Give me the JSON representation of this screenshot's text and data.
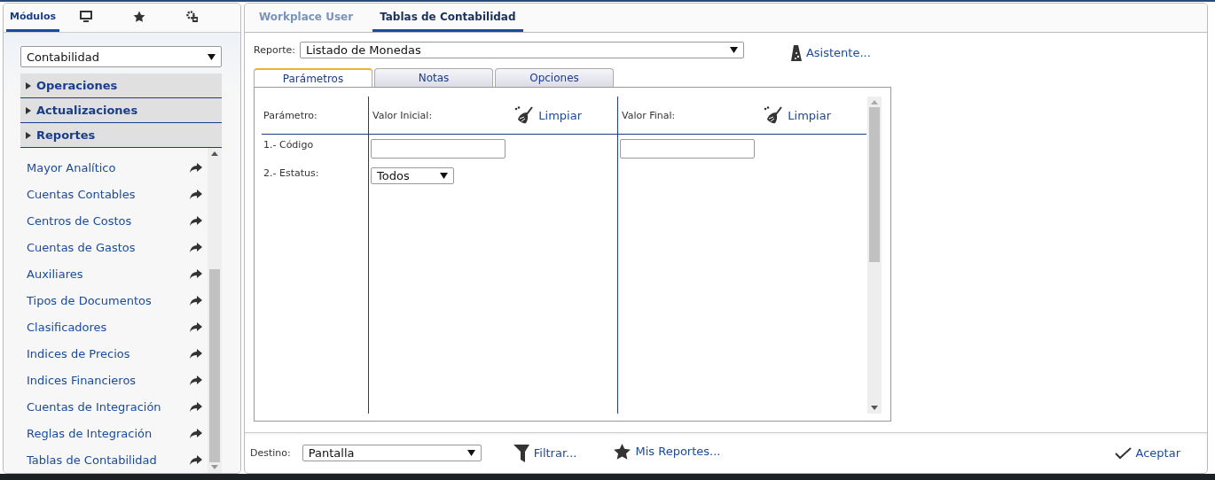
{
  "sidebar": {
    "tabs": [
      {
        "label": "Módulos",
        "selected": true
      },
      {
        "selected": false
      },
      {
        "selected": false
      },
      {
        "selected": false
      }
    ],
    "module_select": {
      "value": "Contabilidad"
    },
    "sections": [
      {
        "label": "Operaciones",
        "expanded": false
      },
      {
        "label": "Actualizaciones",
        "expanded": false
      },
      {
        "label": "Reportes",
        "expanded": false
      }
    ],
    "items": [
      "Mayor Analítico",
      "Cuentas Contables",
      "Centros de Costos",
      "Cuentas de Gastos",
      "Auxiliares",
      "Tipos de Documentos",
      "Clasificadores",
      "Indices de Precios",
      "Indices Financieros",
      "Cuentas de Integración",
      "Reglas de Integración",
      "Tablas de Contabilidad"
    ]
  },
  "tabs": [
    {
      "label": "Workplace User",
      "selected": false
    },
    {
      "label": "Tablas de Contabilidad",
      "selected": true
    }
  ],
  "report": {
    "label": "Reporte:",
    "value": "Listado de Monedas",
    "assistant": "Asistente..."
  },
  "inner_tabs": [
    {
      "label": "Parámetros",
      "selected": true
    },
    {
      "label": "Notas",
      "selected": false
    },
    {
      "label": "Opciones",
      "selected": false
    }
  ],
  "params": {
    "columns": [
      "Parámetro:",
      "Valor Inicial:",
      "Valor Final:"
    ],
    "clear": [
      "Limpiar",
      "Limpiar"
    ],
    "rows": [
      {
        "label": "1.- Código",
        "kind": "text"
      },
      {
        "label": "2.- Estatus:",
        "kind": "select",
        "value": "Todos"
      }
    ]
  },
  "footer": {
    "destination_label": "Destino:",
    "destination": "Pantalla",
    "filter": "Filtrar...",
    "my_reports": "Mis Reportes...",
    "accept": "Aceptar"
  }
}
